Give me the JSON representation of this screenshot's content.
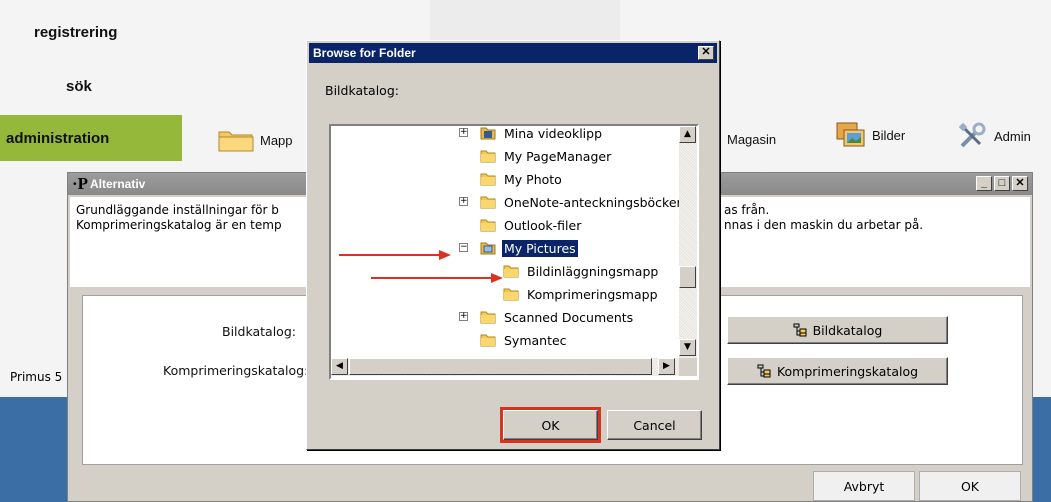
{
  "nav": {
    "registrering": "registrering",
    "sok": "sök",
    "administration": "administration"
  },
  "toolbar": {
    "mapp": "Mapp",
    "magasin": "Magasin",
    "bilder": "Bilder",
    "admin": "Admin"
  },
  "status": {
    "primus": "Primus 5"
  },
  "alternativ": {
    "title": "Alternativ",
    "desc_line1": "Grundläggande inställningar för b",
    "desc_line2": "Komprimeringskatalog är en temp",
    "desc_line1_right": "as från.",
    "desc_line2_right": "nnas i den maskin du arbetar på.",
    "bildkatalog_label": "Bildkatalog:",
    "komprimering_label": "Komprimeringskatalog:",
    "bildkatalog_button": "Bildkatalog",
    "komprimering_button": "Komprimeringskatalog",
    "cancel": "Avbryt",
    "ok": "OK"
  },
  "dialog": {
    "title": "Browse for Folder",
    "label": "Bildkatalog:",
    "ok": "OK",
    "cancel": "Cancel",
    "tree": [
      {
        "name": "Mina videoklipp",
        "expander": "+",
        "icon": "video-folder-icon"
      },
      {
        "name": "My PageManager",
        "expander": "",
        "icon": "folder-icon"
      },
      {
        "name": "My Photo",
        "expander": "",
        "icon": "folder-icon"
      },
      {
        "name": "OneNote-anteckningsböcker",
        "expander": "+",
        "icon": "folder-icon"
      },
      {
        "name": "Outlook-filer",
        "expander": "",
        "icon": "folder-icon"
      },
      {
        "name": "My Pictures",
        "expander": "−",
        "icon": "pictures-folder-icon",
        "selected": true
      },
      {
        "name": "Bildinläggningsmapp",
        "expander": "",
        "icon": "folder-icon"
      },
      {
        "name": "Komprimeringsmapp",
        "expander": "",
        "icon": "folder-icon"
      },
      {
        "name": "Scanned Documents",
        "expander": "+",
        "icon": "folder-icon"
      },
      {
        "name": "Symantec",
        "expander": "",
        "icon": "folder-icon"
      }
    ]
  },
  "colors": {
    "admin_nav": "#95b83b",
    "dialog_title": "#0a246a",
    "annotation": "#d9331f",
    "desktop": "#3a6ea5"
  }
}
